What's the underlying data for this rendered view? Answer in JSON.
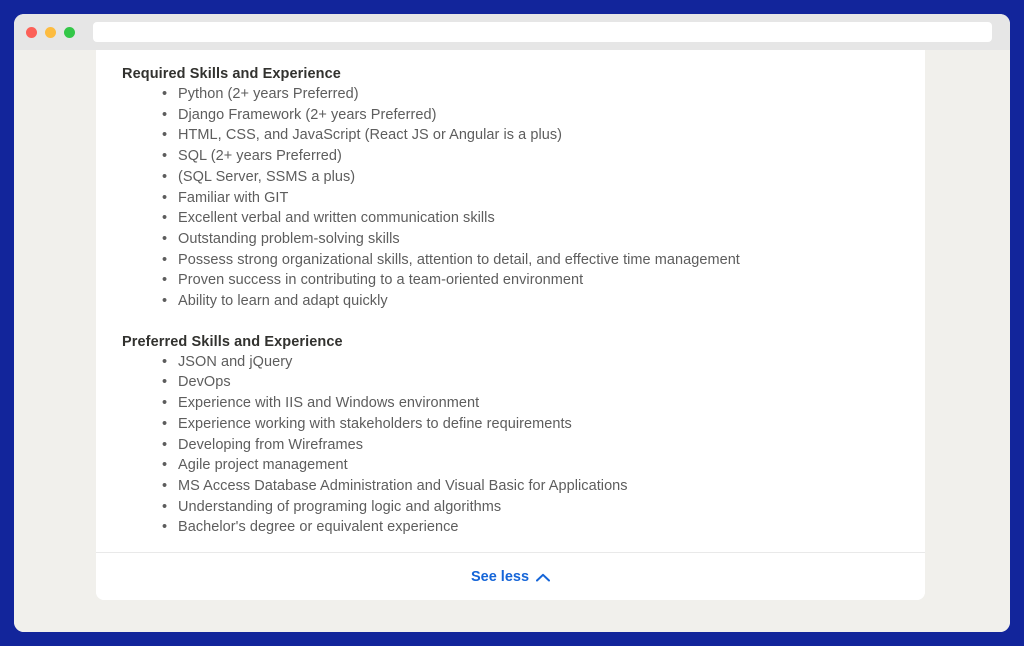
{
  "window": {
    "traffic_lights": [
      {
        "name": "close",
        "color": "#fc6058"
      },
      {
        "name": "minimize",
        "color": "#fdbc40"
      },
      {
        "name": "maximize",
        "color": "#33c748"
      }
    ],
    "url_value": "",
    "url_placeholder": "",
    "frame_color": "#12259b",
    "page_background": "#f1f0ec"
  },
  "job_posting": {
    "sections": [
      {
        "heading": "Required Skills and Experience",
        "items": [
          "Python (2+ years Preferred)",
          "Django Framework (2+ years Preferred)",
          "HTML, CSS, and JavaScript (React JS or Angular is a plus)",
          "SQL (2+ years Preferred)",
          "(SQL Server, SSMS a plus)",
          "Familiar with GIT",
          "Excellent verbal and written communication skills",
          "Outstanding problem-solving skills",
          "Possess strong organizational skills, attention to detail, and effective time management",
          "Proven success in contributing to a team-oriented environment",
          "Ability to learn and adapt quickly"
        ]
      },
      {
        "heading": "Preferred Skills and Experience",
        "items": [
          "JSON and jQuery",
          "DevOps",
          "Experience with IIS and Windows environment",
          "Experience working with stakeholders to define requirements",
          "Developing from Wireframes",
          "Agile project management",
          "MS Access Database Administration and Visual Basic for Applications",
          "Understanding of programing logic and algorithms",
          "Bachelor's degree or equivalent experience"
        ]
      }
    ]
  },
  "footer": {
    "see_less_label": "See less",
    "chevron_icon": "chevron-up-icon",
    "link_color": "#1565d8"
  }
}
